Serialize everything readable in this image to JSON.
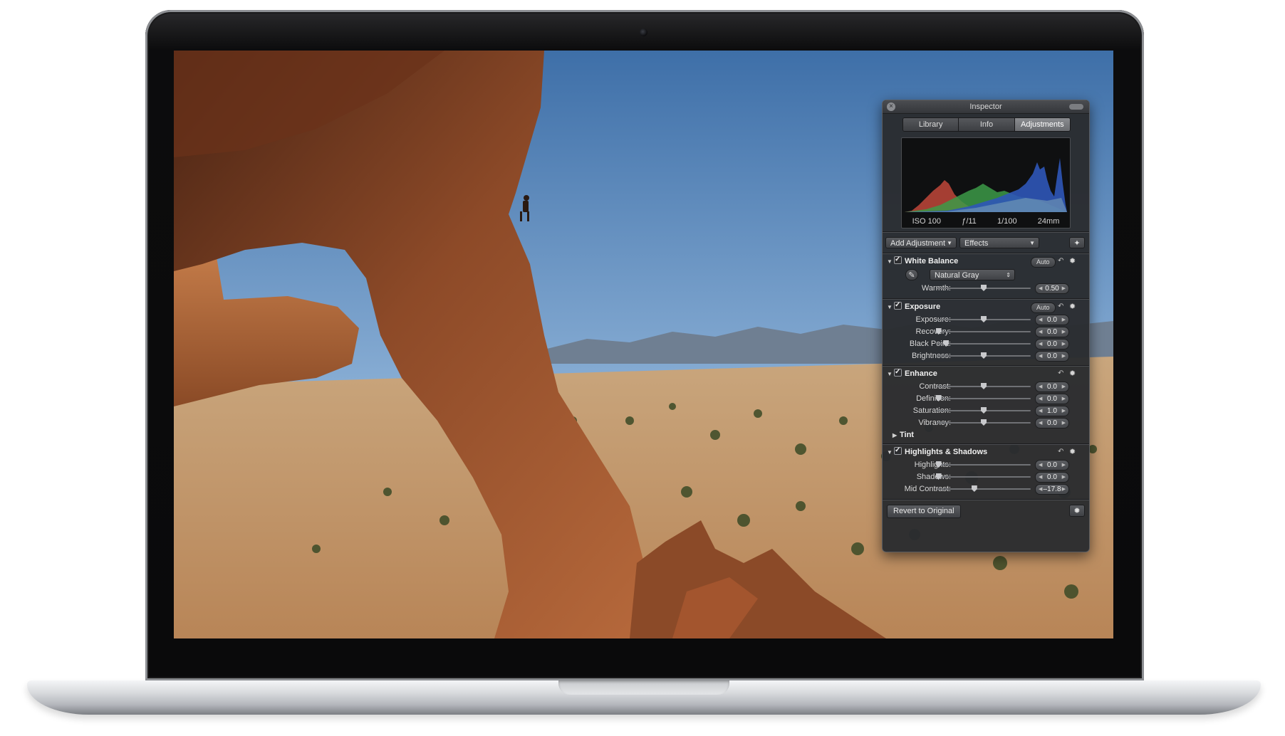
{
  "inspector": {
    "title": "Inspector",
    "tabs": [
      "Library",
      "Info",
      "Adjustments"
    ],
    "active_tab": "Adjustments",
    "histogram": {
      "iso": "ISO 100",
      "aperture": "ƒ/11",
      "shutter": "1/100",
      "focal": "24mm"
    },
    "add_adjustment": "Add Adjustment",
    "effects": "Effects",
    "white_balance": {
      "title": "White Balance",
      "auto": "Auto",
      "preset": "Natural Gray",
      "warmth": {
        "label": "Warmth:",
        "value": "0.50"
      }
    },
    "exposure": {
      "title": "Exposure",
      "auto": "Auto",
      "rows": [
        {
          "label": "Exposure:",
          "value": "0.0"
        },
        {
          "label": "Recovery:",
          "value": "0.0"
        },
        {
          "label": "Black Point:",
          "value": "0.0"
        },
        {
          "label": "Brightness:",
          "value": "0.0"
        }
      ]
    },
    "enhance": {
      "title": "Enhance",
      "rows": [
        {
          "label": "Contrast:",
          "value": "0.0"
        },
        {
          "label": "Definition:",
          "value": "0.0"
        },
        {
          "label": "Saturation:",
          "value": "1.0"
        },
        {
          "label": "Vibrancy:",
          "value": "0.0"
        }
      ],
      "tint": "Tint"
    },
    "highlights_shadows": {
      "title": "Highlights & Shadows",
      "rows": [
        {
          "label": "Highlights:",
          "value": "0.0"
        },
        {
          "label": "Shadows:",
          "value": "0.0"
        },
        {
          "label": "Mid Contrast:",
          "value": "–17.8"
        }
      ]
    },
    "revert": "Revert to Original"
  },
  "icons": {
    "close": "close-icon",
    "wand": "magic-wand-icon",
    "eyedropper": "eyedropper-icon",
    "undo": "undo-arrow-icon",
    "gear": "gear-icon",
    "checkbox": "checkmark-icon"
  },
  "colors": {
    "hud_bg": "#2a2c2f",
    "active_tab": "#7a7c80",
    "sky": "#87a9cf",
    "rock": "#a3552e"
  }
}
